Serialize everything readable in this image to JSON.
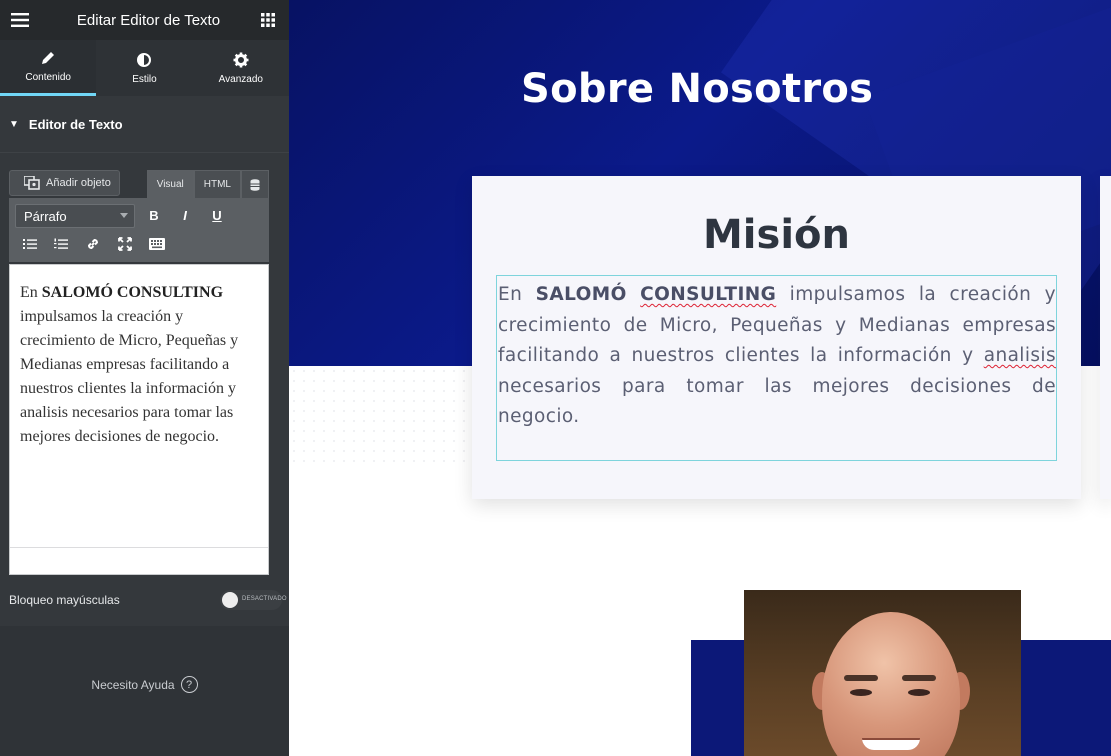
{
  "panel": {
    "header_title": "Editar Editor de Texto",
    "tabs": [
      {
        "label": "Contenido",
        "icon": "pencil-icon"
      },
      {
        "label": "Estilo",
        "icon": "half-circle-icon"
      },
      {
        "label": "Avanzado",
        "icon": "gear-icon"
      }
    ],
    "section_title": "Editor de Texto",
    "add_media_label": "Añadir objeto",
    "mode_tabs": [
      "Visual",
      "HTML"
    ],
    "format_select_value": "Párrafo",
    "toolbar_buttons": [
      "B",
      "I",
      "U"
    ],
    "editor_prefix": "En ",
    "editor_bold": "SALOMÓ CONSULTING",
    "editor_rest": " impulsamos la creación y crecimiento de Micro, Pequeñas y Medianas empresas facilitando a nuestros clientes la información y analisis necesarios para tomar las mejores decisiones de negocio.",
    "caps_lock_label": "Bloqueo mayúsculas",
    "caps_toggle_text": "DESACTIVADO",
    "help_label": "Necesito Ayuda",
    "help_icon": "?"
  },
  "canvas": {
    "section_title": "Sobre Nosotros",
    "card_title": "Misión",
    "card_prefix": "En ",
    "card_bold_1": "SALOMÓ",
    "card_bold_2": "CONSULTING",
    "card_mid": " impulsamos la creación y crecimiento de Micro, Pequeñas y Medianas empresas facilitando a nuestros clientes la información y ",
    "card_misspelled": "analisis",
    "card_end": " necesarios para tomar las mejores decisiones de negocio."
  },
  "colors": {
    "hero_blue": "#0b1a8a",
    "panel_bg": "#34383c",
    "accent_tab": "#71d7f7",
    "editing_border": "#7ed4dc"
  }
}
